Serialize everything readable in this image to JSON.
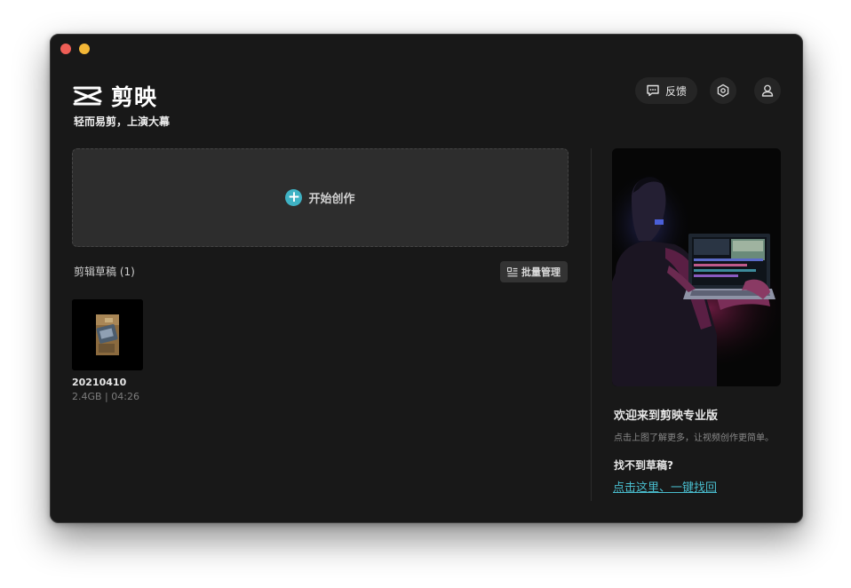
{
  "app": {
    "name": "剪映",
    "slogan": "轻而易剪，上演大幕"
  },
  "header": {
    "feedback_label": "反馈"
  },
  "main": {
    "create_label": "开始创作",
    "drafts_title": "剪辑草稿 (1)",
    "batch_label": "批量管理",
    "drafts": [
      {
        "name": "20210410",
        "meta": "2.4GB | 04:26"
      }
    ]
  },
  "side": {
    "welcome_title": "欢迎来到剪映专业版",
    "welcome_sub": "点击上图了解更多，让视频创作更简单。",
    "lost_title": "找不到草稿?",
    "lost_link": "点击这里、一键找回"
  },
  "colors": {
    "background": "#181818",
    "accent": "#3fb2c4",
    "link": "#49bccd",
    "close": "#ee5e56",
    "minimize": "#f3b736"
  },
  "icons": [
    "logo-mark-icon",
    "feedback-icon",
    "settings-icon",
    "user-icon",
    "plus-icon",
    "batch-manage-icon"
  ]
}
